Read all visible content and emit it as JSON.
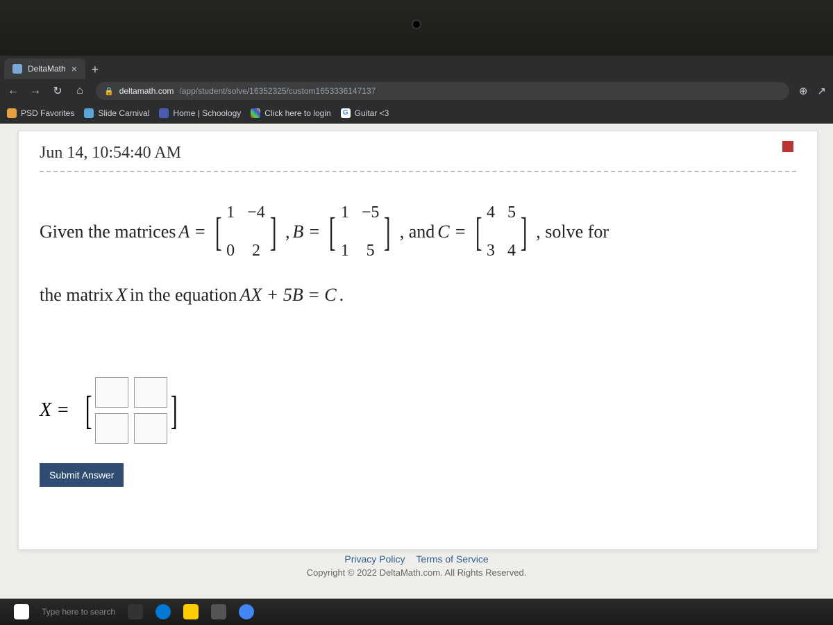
{
  "tab": {
    "title": "DeltaMath",
    "close": "×",
    "new_tab": "+"
  },
  "nav": {
    "back": "←",
    "forward": "→",
    "reload": "↻",
    "home_icon": "⌂"
  },
  "url": {
    "lock": "🔒",
    "domain": "deltamath.com",
    "path": "/app/student/solve/16352325/custom1653336147137"
  },
  "tools": {
    "zoom": "⊕",
    "share": "↗"
  },
  "bookmarks": [
    {
      "label": "PSD Favorites"
    },
    {
      "label": "Slide Carnival"
    },
    {
      "label": "Home | Schoology"
    },
    {
      "label": "Click here to login"
    },
    {
      "label": "Guitar <3",
      "g": "G"
    }
  ],
  "timestamp": "Jun 14, 10:54:40 AM",
  "problem": {
    "lead": "Given the matrices ",
    "Aeq": "A =",
    "A": [
      [
        "1",
        "−4"
      ],
      [
        "0",
        "2"
      ]
    ],
    "comma1": ", ",
    "Beq": "B =",
    "B": [
      [
        "1",
        "−5"
      ],
      [
        "1",
        "5"
      ]
    ],
    "comma2": ", and ",
    "Ceq": "C =",
    "C": [
      [
        "4",
        "5"
      ],
      [
        "3",
        "4"
      ]
    ],
    "tail": ", solve for",
    "line2a": "the matrix ",
    "Xvar": "X",
    "line2b": " in the equation ",
    "eq": "AX + 5B = C",
    "period": "."
  },
  "answer": {
    "Xeq": "X ="
  },
  "submit": "Submit Answer",
  "footer": {
    "privacy": "Privacy Policy",
    "terms": "Terms of Service",
    "copyright": "Copyright © 2022 DeltaMath.com. All Rights Reserved."
  },
  "taskbar": {
    "search": "Type here to search"
  }
}
